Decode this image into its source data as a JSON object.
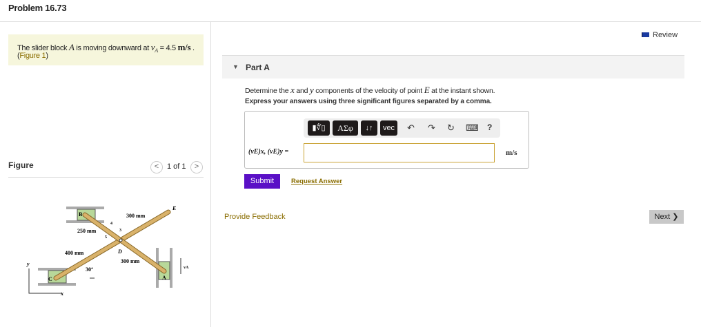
{
  "title": "Problem 16.73",
  "problem": {
    "text_before": "The slider block ",
    "var_A": "A",
    "text_mid": " is moving downward at ",
    "var_vA": "v",
    "sub_A": "A",
    "eq": " = 4.5 ",
    "unit": "m/s",
    "end": " .",
    "figure_link": "Figure 1",
    "paren_open": "(",
    "paren_close": ")"
  },
  "figure": {
    "label": "Figure",
    "pager": "1 of 1",
    "prev": "<",
    "next": ">",
    "labels": {
      "B": "B",
      "C": "C",
      "D": "D",
      "E": "E",
      "A": "A",
      "y": "y",
      "x": "x",
      "vA": "vA",
      "l300a": "300 mm",
      "l250": "250 mm",
      "l400": "400 mm",
      "l300b": "300 mm",
      "angle": "30°",
      "n4": "4",
      "n3": "3",
      "n5": "5"
    }
  },
  "review": "Review",
  "part": {
    "label": "Part A",
    "question_before": "Determine the ",
    "x": "x",
    "and": " and ",
    "y": "y",
    "question_mid": " components of the velocity of point ",
    "E": "E",
    "question_end": " at the instant shown.",
    "instruction": "Express your answers using three significant figures separated by a comma.",
    "toolbar": {
      "templates": "▮∜▯",
      "symbols": "ΑΣφ",
      "arrows": "↓↑",
      "vec": "vec",
      "undo": "↶",
      "redo": "↷",
      "reset": "↻",
      "keyboard": "⌨",
      "help": "?"
    },
    "answer_label": "(vE)x, (vE)y =",
    "answer_value": "",
    "units": "m/s",
    "submit": "Submit",
    "request_answer": "Request Answer"
  },
  "feedback": "Provide Feedback",
  "next": "Next ❯"
}
